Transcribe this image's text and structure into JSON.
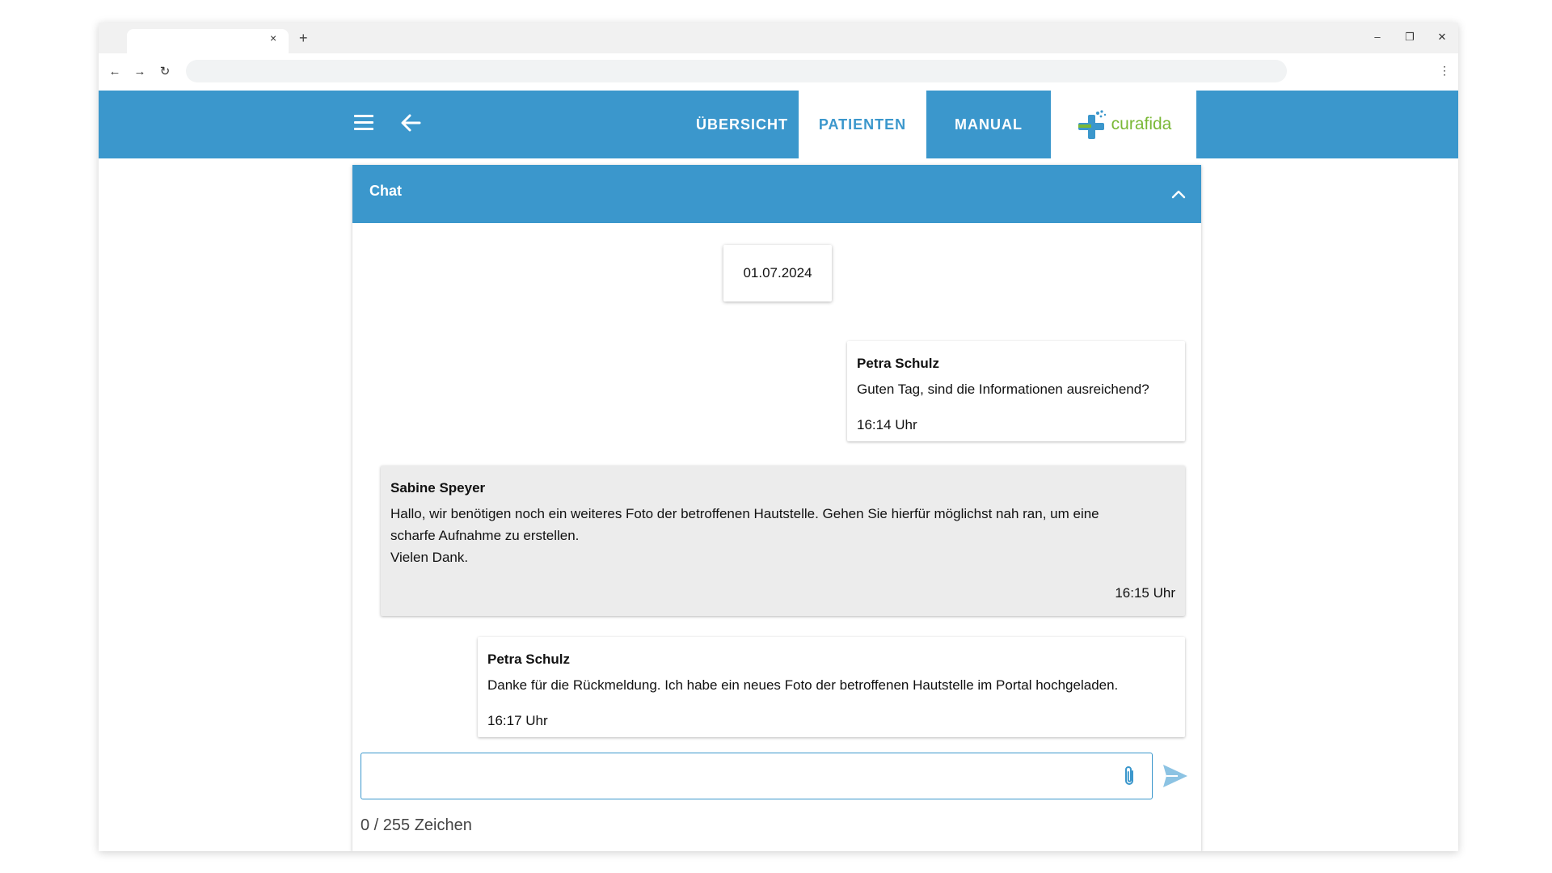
{
  "browser": {
    "tab_close": "×",
    "new_tab": "+",
    "minimize": "–",
    "restore": "❐",
    "close": "✕",
    "back": "←",
    "forward": "→",
    "reload": "↻",
    "menu": "⋮"
  },
  "header": {
    "tabs": [
      {
        "label": "ÜBERSICHT",
        "active": false
      },
      {
        "label": "PATIENTEN",
        "active": true
      },
      {
        "label": "MANUAL",
        "active": false
      }
    ],
    "logo": {
      "text": "curafida"
    },
    "colors": {
      "primary": "#3b97cc",
      "logo_green": "#7ab836"
    }
  },
  "chat": {
    "title": "Chat",
    "date": "01.07.2024",
    "messages": [
      {
        "sender": "Petra Schulz",
        "text": "Guten Tag, sind die Informationen ausreichend?",
        "time": "16:14 Uhr",
        "direction": "outgoing"
      },
      {
        "sender": "Sabine Speyer",
        "text_lines": [
          "Hallo, wir benötigen noch ein weiteres Foto der betroffenen Hautstelle. Gehen Sie hierfür möglichst nah ran, um eine",
          "scharfe Aufnahme zu erstellen.",
          "Vielen Dank."
        ],
        "time": "16:15 Uhr",
        "direction": "incoming"
      },
      {
        "sender": "Petra Schulz",
        "text": "Danke für die Rückmeldung. Ich habe ein neues Foto der betroffenen Hautstelle im Portal hochgeladen.",
        "time": "16:17 Uhr",
        "direction": "outgoing"
      }
    ],
    "input": {
      "value": "",
      "placeholder": ""
    },
    "char_count": "0 / 255 Zeichen"
  }
}
